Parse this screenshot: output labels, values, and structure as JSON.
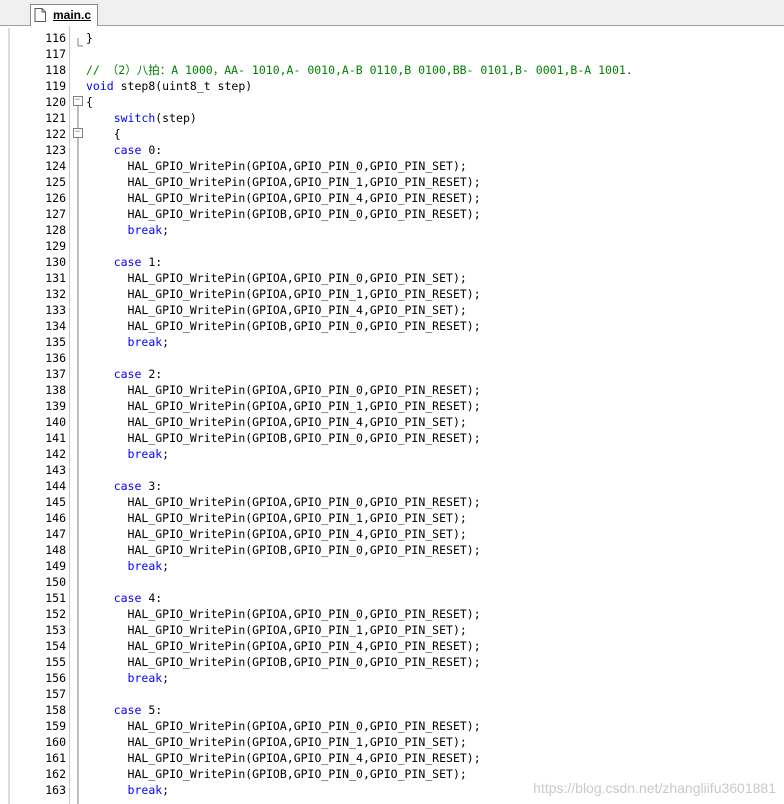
{
  "tab": {
    "label": "main.c"
  },
  "watermark": "https://blog.csdn.net/zhangliifu3601881",
  "lines": [
    {
      "no": "116",
      "fold": "close",
      "tokens": [
        {
          "t": "}"
        }
      ]
    },
    {
      "no": "117",
      "fold": "end",
      "tokens": []
    },
    {
      "no": "118",
      "fold": "",
      "tokens": [
        {
          "t": "// （2）八拍：A 1000，AA- 1010,A- 0010,A-B 0110,B 0100,BB- 0101,B- 0001,B-A 1001.",
          "c": "cm"
        }
      ]
    },
    {
      "no": "119",
      "fold": "",
      "tokens": [
        {
          "t": "void",
          "c": "kw"
        },
        {
          "t": " step8(uint8_t step)"
        }
      ]
    },
    {
      "no": "120",
      "fold": "box",
      "tokens": [
        {
          "t": "{"
        }
      ]
    },
    {
      "no": "121",
      "fold": "line",
      "tokens": [
        {
          "t": "    "
        },
        {
          "t": "switch",
          "c": "kw"
        },
        {
          "t": "(step)"
        }
      ]
    },
    {
      "no": "122",
      "fold": "box",
      "tokens": [
        {
          "t": "    {"
        }
      ]
    },
    {
      "no": "123",
      "fold": "line",
      "tokens": [
        {
          "t": "    "
        },
        {
          "t": "case",
          "c": "kw"
        },
        {
          "t": " 0:"
        }
      ]
    },
    {
      "no": "124",
      "fold": "line",
      "tokens": [
        {
          "t": "      HAL_GPIO_WritePin(GPIOA,GPIO_PIN_0,GPIO_PIN_SET);"
        }
      ]
    },
    {
      "no": "125",
      "fold": "line",
      "tokens": [
        {
          "t": "      HAL_GPIO_WritePin(GPIOA,GPIO_PIN_1,GPIO_PIN_RESET);"
        }
      ]
    },
    {
      "no": "126",
      "fold": "line",
      "tokens": [
        {
          "t": "      HAL_GPIO_WritePin(GPIOA,GPIO_PIN_4,GPIO_PIN_RESET);"
        }
      ]
    },
    {
      "no": "127",
      "fold": "line",
      "tokens": [
        {
          "t": "      HAL_GPIO_WritePin(GPIOB,GPIO_PIN_0,GPIO_PIN_RESET);"
        }
      ]
    },
    {
      "no": "128",
      "fold": "line",
      "tokens": [
        {
          "t": "      "
        },
        {
          "t": "break",
          "c": "kw"
        },
        {
          "t": ";"
        }
      ]
    },
    {
      "no": "129",
      "fold": "line",
      "tokens": []
    },
    {
      "no": "130",
      "fold": "line",
      "tokens": [
        {
          "t": "    "
        },
        {
          "t": "case",
          "c": "kw"
        },
        {
          "t": " 1:"
        }
      ]
    },
    {
      "no": "131",
      "fold": "line",
      "tokens": [
        {
          "t": "      HAL_GPIO_WritePin(GPIOA,GPIO_PIN_0,GPIO_PIN_SET);"
        }
      ]
    },
    {
      "no": "132",
      "fold": "line",
      "tokens": [
        {
          "t": "      HAL_GPIO_WritePin(GPIOA,GPIO_PIN_1,GPIO_PIN_RESET);"
        }
      ]
    },
    {
      "no": "133",
      "fold": "line",
      "tokens": [
        {
          "t": "      HAL_GPIO_WritePin(GPIOA,GPIO_PIN_4,GPIO_PIN_SET);"
        }
      ]
    },
    {
      "no": "134",
      "fold": "line",
      "tokens": [
        {
          "t": "      HAL_GPIO_WritePin(GPIOB,GPIO_PIN_0,GPIO_PIN_RESET);"
        }
      ]
    },
    {
      "no": "135",
      "fold": "line",
      "tokens": [
        {
          "t": "      "
        },
        {
          "t": "break",
          "c": "kw"
        },
        {
          "t": ";"
        }
      ]
    },
    {
      "no": "136",
      "fold": "line",
      "tokens": []
    },
    {
      "no": "137",
      "fold": "line",
      "tokens": [
        {
          "t": "    "
        },
        {
          "t": "case",
          "c": "kw"
        },
        {
          "t": " 2:"
        }
      ]
    },
    {
      "no": "138",
      "fold": "line",
      "tokens": [
        {
          "t": "      HAL_GPIO_WritePin(GPIOA,GPIO_PIN_0,GPIO_PIN_RESET);"
        }
      ]
    },
    {
      "no": "139",
      "fold": "line",
      "tokens": [
        {
          "t": "      HAL_GPIO_WritePin(GPIOA,GPIO_PIN_1,GPIO_PIN_RESET);"
        }
      ]
    },
    {
      "no": "140",
      "fold": "line",
      "tokens": [
        {
          "t": "      HAL_GPIO_WritePin(GPIOA,GPIO_PIN_4,GPIO_PIN_SET);"
        }
      ]
    },
    {
      "no": "141",
      "fold": "line",
      "tokens": [
        {
          "t": "      HAL_GPIO_WritePin(GPIOB,GPIO_PIN_0,GPIO_PIN_RESET);"
        }
      ]
    },
    {
      "no": "142",
      "fold": "line",
      "tokens": [
        {
          "t": "      "
        },
        {
          "t": "break",
          "c": "kw"
        },
        {
          "t": ";"
        }
      ]
    },
    {
      "no": "143",
      "fold": "line",
      "tokens": []
    },
    {
      "no": "144",
      "fold": "line",
      "tokens": [
        {
          "t": "    "
        },
        {
          "t": "case",
          "c": "kw"
        },
        {
          "t": " 3:"
        }
      ]
    },
    {
      "no": "145",
      "fold": "line",
      "tokens": [
        {
          "t": "      HAL_GPIO_WritePin(GPIOA,GPIO_PIN_0,GPIO_PIN_RESET);"
        }
      ]
    },
    {
      "no": "146",
      "fold": "line",
      "tokens": [
        {
          "t": "      HAL_GPIO_WritePin(GPIOA,GPIO_PIN_1,GPIO_PIN_SET);"
        }
      ]
    },
    {
      "no": "147",
      "fold": "line",
      "tokens": [
        {
          "t": "      HAL_GPIO_WritePin(GPIOA,GPIO_PIN_4,GPIO_PIN_SET);"
        }
      ]
    },
    {
      "no": "148",
      "fold": "line",
      "tokens": [
        {
          "t": "      HAL_GPIO_WritePin(GPIOB,GPIO_PIN_0,GPIO_PIN_RESET);"
        }
      ]
    },
    {
      "no": "149",
      "fold": "line",
      "tokens": [
        {
          "t": "      "
        },
        {
          "t": "break",
          "c": "kw"
        },
        {
          "t": ";"
        }
      ]
    },
    {
      "no": "150",
      "fold": "line",
      "tokens": []
    },
    {
      "no": "151",
      "fold": "line",
      "tokens": [
        {
          "t": "    "
        },
        {
          "t": "case",
          "c": "kw"
        },
        {
          "t": " 4:"
        }
      ]
    },
    {
      "no": "152",
      "fold": "line",
      "tokens": [
        {
          "t": "      HAL_GPIO_WritePin(GPIOA,GPIO_PIN_0,GPIO_PIN_RESET);"
        }
      ]
    },
    {
      "no": "153",
      "fold": "line",
      "tokens": [
        {
          "t": "      HAL_GPIO_WritePin(GPIOA,GPIO_PIN_1,GPIO_PIN_SET);"
        }
      ]
    },
    {
      "no": "154",
      "fold": "line",
      "tokens": [
        {
          "t": "      HAL_GPIO_WritePin(GPIOA,GPIO_PIN_4,GPIO_PIN_RESET);"
        }
      ]
    },
    {
      "no": "155",
      "fold": "line",
      "tokens": [
        {
          "t": "      HAL_GPIO_WritePin(GPIOB,GPIO_PIN_0,GPIO_PIN_RESET);"
        }
      ]
    },
    {
      "no": "156",
      "fold": "line",
      "tokens": [
        {
          "t": "      "
        },
        {
          "t": "break",
          "c": "kw"
        },
        {
          "t": ";"
        }
      ]
    },
    {
      "no": "157",
      "fold": "line",
      "tokens": []
    },
    {
      "no": "158",
      "fold": "line",
      "tokens": [
        {
          "t": "    "
        },
        {
          "t": "case",
          "c": "kw"
        },
        {
          "t": " 5:"
        }
      ]
    },
    {
      "no": "159",
      "fold": "line",
      "tokens": [
        {
          "t": "      HAL_GPIO_WritePin(GPIOA,GPIO_PIN_0,GPIO_PIN_RESET);"
        }
      ]
    },
    {
      "no": "160",
      "fold": "line",
      "tokens": [
        {
          "t": "      HAL_GPIO_WritePin(GPIOA,GPIO_PIN_1,GPIO_PIN_SET);"
        }
      ]
    },
    {
      "no": "161",
      "fold": "line",
      "tokens": [
        {
          "t": "      HAL_GPIO_WritePin(GPIOA,GPIO_PIN_4,GPIO_PIN_RESET);"
        }
      ]
    },
    {
      "no": "162",
      "fold": "line",
      "tokens": [
        {
          "t": "      HAL_GPIO_WritePin(GPIOB,GPIO_PIN_0,GPIO_PIN_SET);"
        }
      ]
    },
    {
      "no": "163",
      "fold": "line",
      "tokens": [
        {
          "t": "      "
        },
        {
          "t": "break",
          "c": "kw"
        },
        {
          "t": ";"
        }
      ]
    }
  ]
}
